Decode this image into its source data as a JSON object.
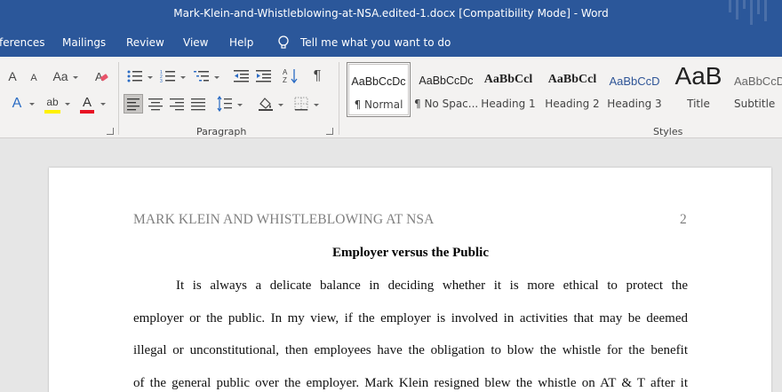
{
  "window": {
    "title": "Mark-Klein-and-Whistleblowing-at-NSA.edited-1.docx [Compatibility Mode]  -  Word"
  },
  "menu": {
    "tabs": [
      "ferences",
      "Mailings",
      "Review",
      "View",
      "Help"
    ],
    "tell_me": "Tell me what you want to do"
  },
  "ribbon": {
    "font_group": {
      "grow_font": "A",
      "shrink_font": "A",
      "change_case": "Aa",
      "font_color_letter": "A",
      "text_effects_letter": "A",
      "highlight_letters": "ab",
      "colors": {
        "font_color": "#e81123",
        "highlight": "#fff100"
      }
    },
    "paragraph_group": {
      "label": "Paragraph",
      "show_marks": "¶"
    },
    "styles_group": {
      "label": "Styles",
      "items": [
        {
          "sample": "AaBbCcDc",
          "name": "¶ Normal",
          "selected": true
        },
        {
          "sample": "AaBbCcDc",
          "name": "¶ No Spac..."
        },
        {
          "sample": "AaBbCcl",
          "name": "Heading 1"
        },
        {
          "sample": "AaBbCcl",
          "name": "Heading 2"
        },
        {
          "sample": "AaBbCcD",
          "name": "Heading 3"
        },
        {
          "sample": "AaB",
          "name": "Title"
        },
        {
          "sample": "AaBbCcD",
          "name": "Subtitle"
        }
      ]
    }
  },
  "document": {
    "running_head": "MARK KLEIN AND WHISTLEBLOWING AT NSA",
    "page_number": "2",
    "heading": "Employer versus the Public",
    "lines": [
      "It is always a delicate balance in deciding whether it is more ethical to protect the",
      "employer or the public. In my view, if the employer is involved in activities that may be deemed",
      "illegal or unconstitutional, then employees have the obligation to blow the whistle for the benefit",
      "of the general public over the employer. Mark Klein resigned blew the whistle on AT & T after it"
    ]
  }
}
